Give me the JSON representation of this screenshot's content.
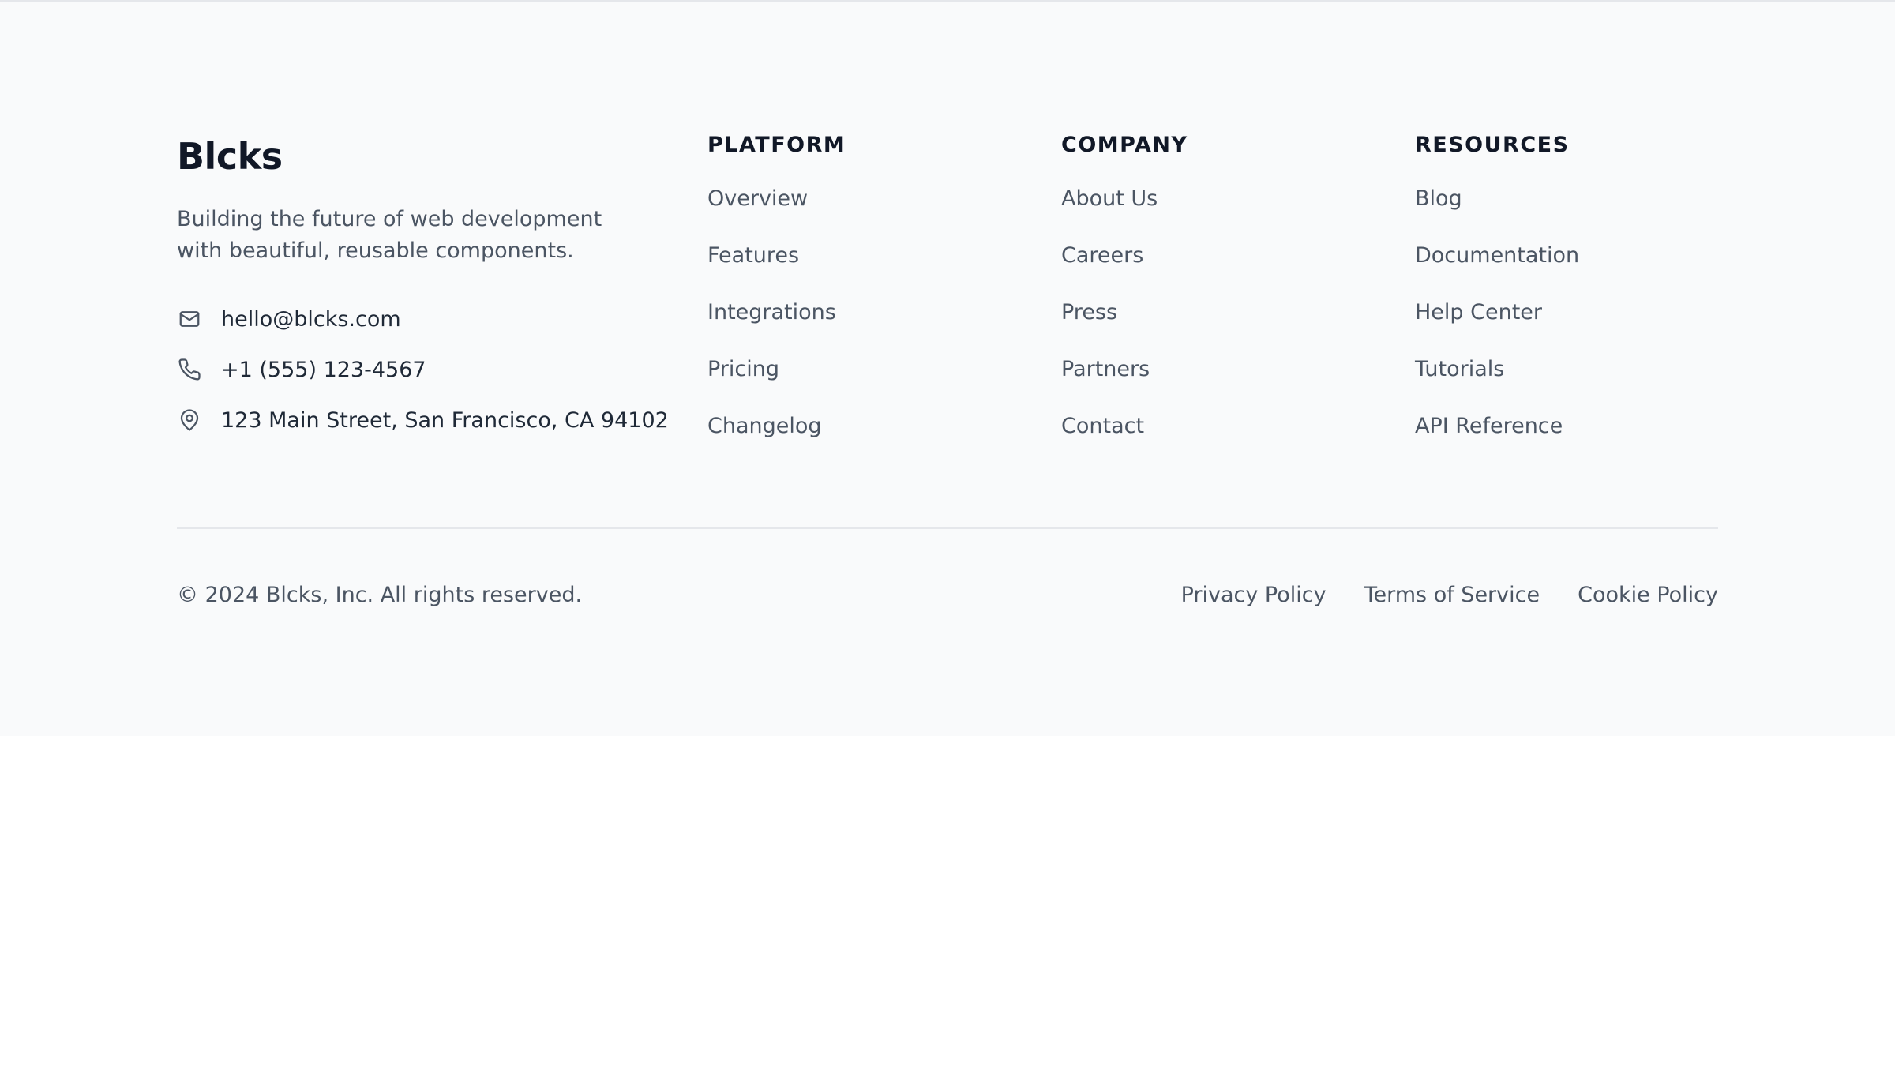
{
  "brand": {
    "name": "Blcks",
    "description": "Building the future of web development with beautiful, reusable components."
  },
  "contact": {
    "email": "hello@blcks.com",
    "phone": "+1 (555) 123-4567",
    "address": "123 Main Street, San Francisco, CA 94102"
  },
  "columns": [
    {
      "heading": "PLATFORM",
      "links": [
        "Overview",
        "Features",
        "Integrations",
        "Pricing",
        "Changelog"
      ]
    },
    {
      "heading": "COMPANY",
      "links": [
        "About Us",
        "Careers",
        "Press",
        "Partners",
        "Contact"
      ]
    },
    {
      "heading": "RESOURCES",
      "links": [
        "Blog",
        "Documentation",
        "Help Center",
        "Tutorials",
        "API Reference"
      ]
    }
  ],
  "bottom": {
    "copyright": "© 2024 Blcks, Inc. All rights reserved.",
    "legal_links": [
      "Privacy Policy",
      "Terms of Service",
      "Cookie Policy"
    ]
  },
  "icons": {
    "email": "mail-icon",
    "phone": "phone-icon",
    "address": "map-pin-icon"
  },
  "colors": {
    "footer_bg": "#f9fafb",
    "heading": "#111827",
    "text": "#4b5563",
    "divider": "#e5e7eb"
  }
}
